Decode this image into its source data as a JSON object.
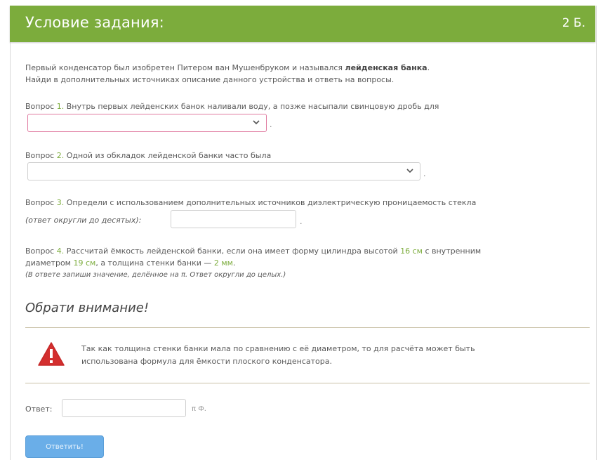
{
  "header": {
    "title": "Условие задания:",
    "points": "2 Б."
  },
  "intro": {
    "line1_prefix": "Первый конденсатор был изобретен Питером ван Мушенбруком и назывался ",
    "line1_bold": "лейденская банка",
    "line1_suffix": ".",
    "line2": "Найди в дополнительных источниках описание данного устройства и ответь на вопросы."
  },
  "q1": {
    "word": "Вопрос",
    "num": "1.",
    "text": " Внутрь первых лейденских банок наливали воду, а позже насыпали свинцовую дробь для",
    "after": "."
  },
  "q2": {
    "word": "Вопрос",
    "num": "2.",
    "text": " Одной из обкладок лейденской банки часто была",
    "after": "."
  },
  "q3": {
    "word": "Вопрос",
    "num": "3.",
    "text": " Определи с использованием дополнительных источников диэлектрическую проницаемость стекла",
    "note": "(ответ округли до десятых):",
    "after": "."
  },
  "q4": {
    "word": "Вопрос",
    "num": "4.",
    "t1": " Рассчитай ёмкость лейденской банки, если она имеет форму цилиндра высотой ",
    "height": "16 см",
    "t2": " с внутренним",
    "t3": "диаметром ",
    "diameter": "19 см",
    "t4": ", а толщина стенки банки — ",
    "thickness": "2 мм",
    "t5": ".",
    "note": "(В ответе запиши значение, делённое на π. Ответ округли до целых.)"
  },
  "notice": {
    "title": "Обрати внимание!",
    "line1": "Так как толщина стенки банки мала по сравнению с её диаметром, то для расчёта может быть",
    "line2": "использована формула для ёмкости плоского конденсатора."
  },
  "answer": {
    "label": "Ответ:",
    "unit": "π Ф."
  },
  "submit": {
    "label": "Ответить!"
  },
  "colors": {
    "accent": "#7cac3c",
    "button": "#6aaee8",
    "warning": "#d32f2f"
  },
  "icons": {
    "select_arrow": "chevron-down-icon",
    "warning": "warning-triangle-icon"
  }
}
